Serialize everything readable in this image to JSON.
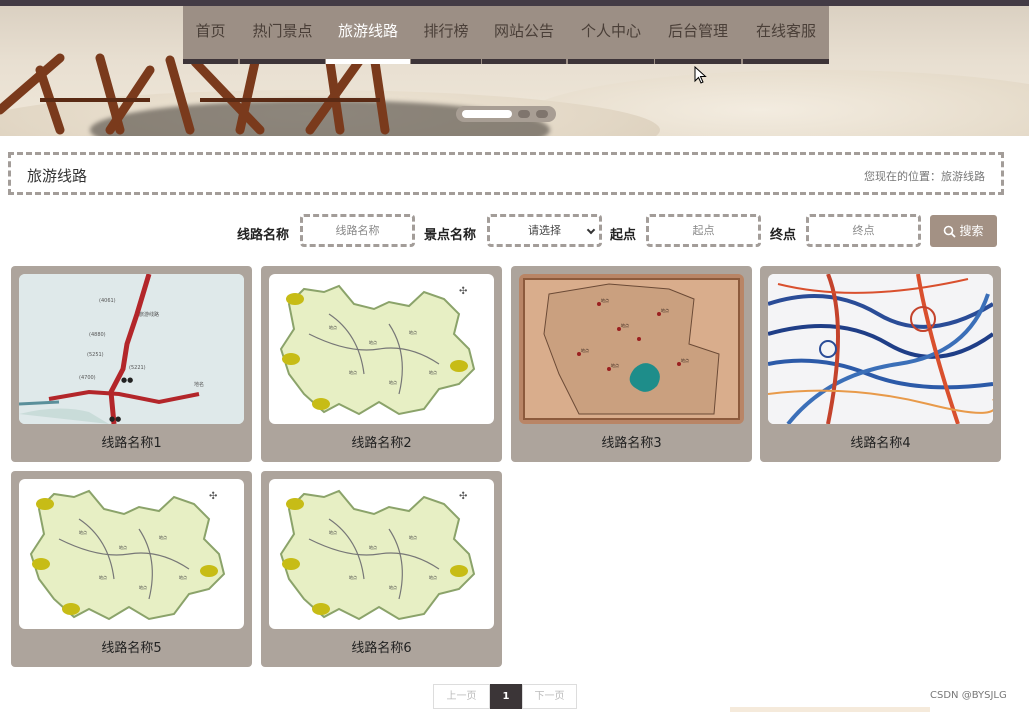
{
  "nav": {
    "items": [
      {
        "label": "首页"
      },
      {
        "label": "热门景点"
      },
      {
        "label": "旅游线路",
        "active": true
      },
      {
        "label": "排行榜"
      },
      {
        "label": "网站公告"
      },
      {
        "label": "个人中心"
      },
      {
        "label": "后台管理"
      },
      {
        "label": "在线客服"
      }
    ]
  },
  "slider": {
    "active_index": 0,
    "count": 3
  },
  "section": {
    "title": "旅游线路",
    "breadcrumb": "您现在的位置：旅游线路"
  },
  "search": {
    "route_name_label": "线路名称",
    "route_name_placeholder": "线路名称",
    "spot_name_label": "景点名称",
    "spot_name_value": "请选择",
    "start_label": "起点",
    "start_placeholder": "起点",
    "end_label": "终点",
    "end_placeholder": "终点",
    "button_label": "搜索"
  },
  "cards": [
    {
      "name": "线路名称1",
      "map": "road-map"
    },
    {
      "name": "线路名称2",
      "map": "province-map"
    },
    {
      "name": "线路名称3",
      "map": "parchment-map"
    },
    {
      "name": "线路名称4",
      "map": "rail-map"
    },
    {
      "name": "线路名称5",
      "map": "province-map"
    },
    {
      "name": "线路名称6",
      "map": "province-map"
    }
  ],
  "pagination": {
    "prev_label": "上一页",
    "current": "1",
    "next_label": "下一页"
  },
  "watermark": "CSDN @BYSJLG",
  "colors": {
    "navbar": "#9c8f85",
    "card": "#ada49c",
    "button": "#a39184",
    "active_page": "#3b3537"
  }
}
